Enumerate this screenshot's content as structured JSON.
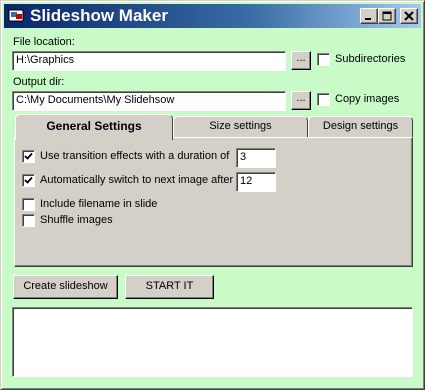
{
  "window": {
    "title": "Slideshow Maker",
    "minimize_icon": "minimize-icon",
    "maximize_icon": "maximize-icon",
    "close_icon": "close-icon"
  },
  "file_location": {
    "label": "File location:",
    "value": "H:\\Graphics",
    "browse_label": "...",
    "subdirectories_label": "Subdirectories",
    "subdirectories_checked": false
  },
  "output_dir": {
    "label": "Output dir:",
    "value": "C:\\My Documents\\My Slidehsow",
    "browse_label": "...",
    "copy_images_label": "Copy images",
    "copy_images_checked": false
  },
  "tabs": [
    {
      "label": "General Settings",
      "active": true
    },
    {
      "label": "Size settings",
      "active": false
    },
    {
      "label": "Design settings",
      "active": false
    }
  ],
  "general": {
    "transition_label": "Use transition effects with a duration of",
    "transition_checked": true,
    "transition_value": "3",
    "autoswitch_label": "Automatically switch to next image after",
    "autoswitch_checked": true,
    "autoswitch_value": "12",
    "filename_label": "Include filename in slide",
    "filename_checked": false,
    "shuffle_label": "Shuffle images",
    "shuffle_checked": false
  },
  "actions": {
    "create_label": "Create slideshow",
    "start_label": "START IT"
  },
  "output_log": ""
}
